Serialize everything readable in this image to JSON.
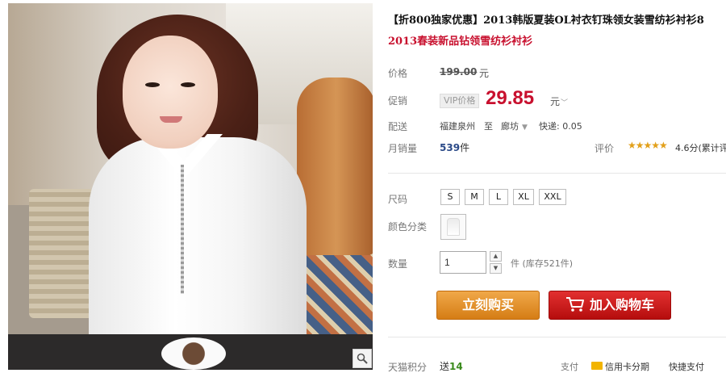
{
  "product": {
    "title": "【折800独家优惠】2013韩版夏装OL衬衣钉珠领女装雪纺衫衬衫8",
    "subtitle": "2013春装新品钻领雪纺衫衬衫"
  },
  "price": {
    "label": "价格",
    "original": "199.00",
    "unit": "元"
  },
  "promo": {
    "label": "促销",
    "vip_tag": "VIP价格",
    "price": "29.85",
    "unit": "元"
  },
  "shipping": {
    "label": "配送",
    "from": "福建泉州",
    "to_word": "至",
    "city": "廊坊",
    "fee": "快递: 0.05"
  },
  "sales": {
    "label": "月销量",
    "count": "539",
    "unit": "件",
    "rating_label": "评价",
    "stars": "★★★★★",
    "score": "4.6分(累计评"
  },
  "size": {
    "label": "尺码",
    "options": [
      "S",
      "M",
      "L",
      "XL",
      "XXL"
    ]
  },
  "color": {
    "label": "颜色分类"
  },
  "quantity": {
    "label": "数量",
    "value": "1",
    "stock": "件 (库存521件)"
  },
  "actions": {
    "buy_now": "立刻购买",
    "add_to_cart": "加入购物车"
  },
  "points": {
    "label": "天猫积分",
    "prefix": "送",
    "value": "14"
  },
  "payment": {
    "label": "支付",
    "credit_card": "信用卡分期",
    "quick_pay": "快捷支付"
  },
  "colors": {
    "accent_red": "#c8102e",
    "buy_orange": "#e3902f",
    "cart_red": "#c91818"
  }
}
